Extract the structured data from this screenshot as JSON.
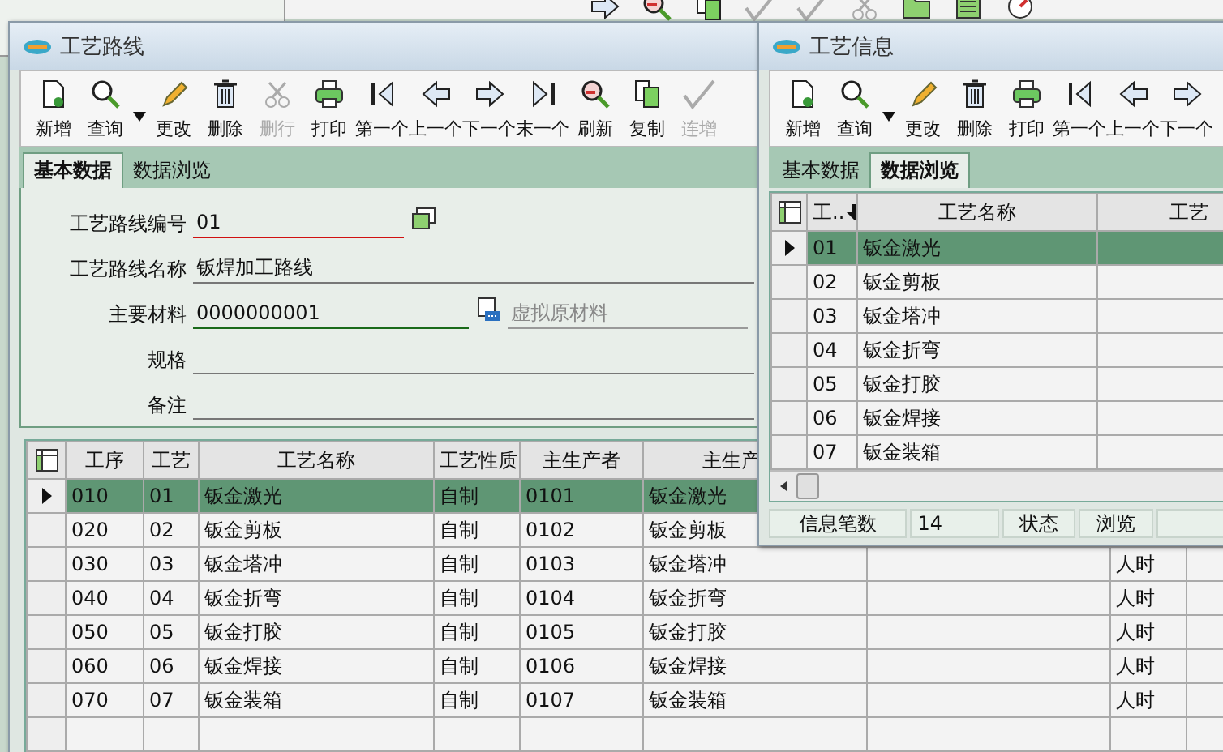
{
  "route_window": {
    "title": "工艺路线",
    "toolbar": [
      {
        "kind": "new",
        "label": "新增",
        "disabled": false,
        "dropdown": false
      },
      {
        "kind": "query",
        "label": "查询",
        "disabled": false,
        "dropdown": true
      },
      {
        "kind": "edit",
        "label": "更改",
        "disabled": false,
        "dropdown": false
      },
      {
        "kind": "delete",
        "label": "删除",
        "disabled": false,
        "dropdown": false
      },
      {
        "kind": "cut",
        "label": "删行",
        "disabled": true,
        "dropdown": false
      },
      {
        "kind": "print",
        "label": "打印",
        "disabled": false,
        "dropdown": false
      },
      {
        "kind": "first",
        "label": "第一个",
        "disabled": false,
        "dropdown": false
      },
      {
        "kind": "prev",
        "label": "上一个",
        "disabled": false,
        "dropdown": false
      },
      {
        "kind": "next",
        "label": "下一个",
        "disabled": false,
        "dropdown": false
      },
      {
        "kind": "last",
        "label": "末一个",
        "disabled": false,
        "dropdown": false
      },
      {
        "kind": "refresh",
        "label": "刷新",
        "disabled": false,
        "dropdown": false
      },
      {
        "kind": "copy",
        "label": "复制",
        "disabled": false,
        "dropdown": false
      },
      {
        "kind": "check",
        "label": "连增",
        "disabled": true,
        "dropdown": false
      }
    ],
    "tabs": [
      {
        "label": "基本数据",
        "selected": true
      },
      {
        "label": "数据浏览",
        "selected": false
      }
    ],
    "form": [
      {
        "label": "工艺路线编号",
        "value": "01",
        "kind": "required"
      },
      {
        "label": "工艺路线名称",
        "value": "钣焊加工路线",
        "kind": "plain"
      },
      {
        "label": "主要材料",
        "value": "0000000001",
        "kind": "lookup",
        "lookup_value": "虚拟原材料"
      },
      {
        "label": "规格",
        "kind": "plain"
      },
      {
        "label": "备注",
        "kind": "plain"
      }
    ],
    "table": {
      "columns": [
        "工序",
        "工艺",
        "工艺名称",
        "工艺性质",
        "主生产者",
        "主生产"
      ],
      "rows": [
        {
          "selected": true,
          "cells": [
            "010",
            "01",
            "钣金激光",
            "自制",
            "0101",
            "钣金激光"
          ]
        },
        {
          "selected": false,
          "cells": [
            "020",
            "02",
            "钣金剪板",
            "自制",
            "0102",
            "钣金剪板"
          ]
        },
        {
          "selected": false,
          "cells": [
            "030",
            "03",
            "钣金塔冲",
            "自制",
            "0103",
            "钣金塔冲"
          ],
          "column_9": "人时"
        },
        {
          "selected": false,
          "cells": [
            "040",
            "04",
            "钣金折弯",
            "自制",
            "0104",
            "钣金折弯"
          ],
          "column_9": "人时"
        },
        {
          "selected": false,
          "cells": [
            "050",
            "05",
            "钣金打胶",
            "自制",
            "0105",
            "钣金打胶"
          ],
          "column_9": "人时"
        },
        {
          "selected": false,
          "cells": [
            "060",
            "06",
            "钣金焊接",
            "自制",
            "0106",
            "钣金焊接"
          ],
          "column_9": "人时"
        },
        {
          "selected": false,
          "cells": [
            "070",
            "07",
            "钣金装箱",
            "自制",
            "0107",
            "钣金装箱"
          ],
          "column_9": "人时"
        }
      ]
    }
  },
  "info_window": {
    "title": "工艺信息",
    "toolbar": [
      {
        "kind": "new",
        "label": "新增",
        "disabled": false,
        "dropdown": false
      },
      {
        "kind": "query",
        "label": "查询",
        "disabled": false,
        "dropdown": true
      },
      {
        "kind": "edit",
        "label": "更改",
        "disabled": false,
        "dropdown": false
      },
      {
        "kind": "delete",
        "label": "删除",
        "disabled": false,
        "dropdown": false
      },
      {
        "kind": "print",
        "label": "打印",
        "disabled": false,
        "dropdown": false
      },
      {
        "kind": "first",
        "label": "第一个",
        "disabled": false,
        "dropdown": false
      },
      {
        "kind": "prev",
        "label": "上一个",
        "disabled": false,
        "dropdown": false
      },
      {
        "kind": "next",
        "label": "下一个",
        "disabled": false,
        "dropdown": false
      }
    ],
    "tabs": [
      {
        "label": "基本数据",
        "selected": false
      },
      {
        "label": "数据浏览",
        "selected": true
      }
    ],
    "table": {
      "columns": [
        {
          "label": "工..",
          "sort_descending": true
        },
        {
          "label": "工艺名称"
        },
        {
          "label": "工艺"
        }
      ],
      "rows": [
        {
          "selected": true,
          "cells": [
            "01",
            "钣金激光"
          ]
        },
        {
          "selected": false,
          "cells": [
            "02",
            "钣金剪板"
          ]
        },
        {
          "selected": false,
          "cells": [
            "03",
            "钣金塔冲"
          ]
        },
        {
          "selected": false,
          "cells": [
            "04",
            "钣金折弯"
          ]
        },
        {
          "selected": false,
          "cells": [
            "05",
            "钣金打胶"
          ]
        },
        {
          "selected": false,
          "cells": [
            "06",
            "钣金焊接"
          ]
        },
        {
          "selected": false,
          "cells": [
            "07",
            "钣金装箱"
          ]
        }
      ]
    },
    "status_bar": [
      "信息笔数",
      "14",
      "状态",
      "浏览"
    ]
  }
}
